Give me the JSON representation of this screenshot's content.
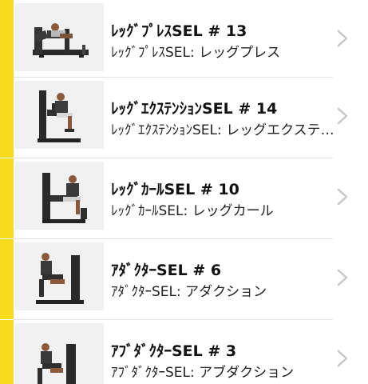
{
  "colors": {
    "accent": "#f7dc1e",
    "divider": "#e2e2e2",
    "chevron": "#c7c7cc",
    "machine": "#2a2a2a",
    "thumb_bg": "#f1f1f1"
  },
  "items": [
    {
      "title": "ﾚｯｸﾞﾌﾟﾚｽSEL # 13",
      "subtitle": "ﾚｯｸﾞﾌﾟﾚｽSEL: レッグプレス",
      "thumbnail_icon": "leg-press-machine-icon"
    },
    {
      "title": "ﾚｯｸﾞｴｸｽﾃﾝｼｮﾝSEL # 14",
      "subtitle": "ﾚｯｸﾞｴｸｽﾃﾝｼｮﾝSEL: レッグエクステンション",
      "thumbnail_icon": "leg-extension-machine-icon"
    },
    {
      "title": "ﾚｯｸﾞｶｰﾙSEL # 10",
      "subtitle": "ﾚｯｸﾞｶｰﾙSEL: レッグカール",
      "thumbnail_icon": "leg-curl-machine-icon"
    },
    {
      "title": "ｱﾀﾞｸﾀｰSEL # 6",
      "subtitle": "ｱﾀﾞｸﾀｰSEL: アダクション",
      "thumbnail_icon": "adductor-machine-icon"
    },
    {
      "title": "ｱﾌﾞﾀﾞｸﾀｰSEL # 3",
      "subtitle": "ｱﾌﾞﾀﾞｸﾀｰSEL: アブダクション",
      "thumbnail_icon": "abductor-machine-icon"
    }
  ]
}
